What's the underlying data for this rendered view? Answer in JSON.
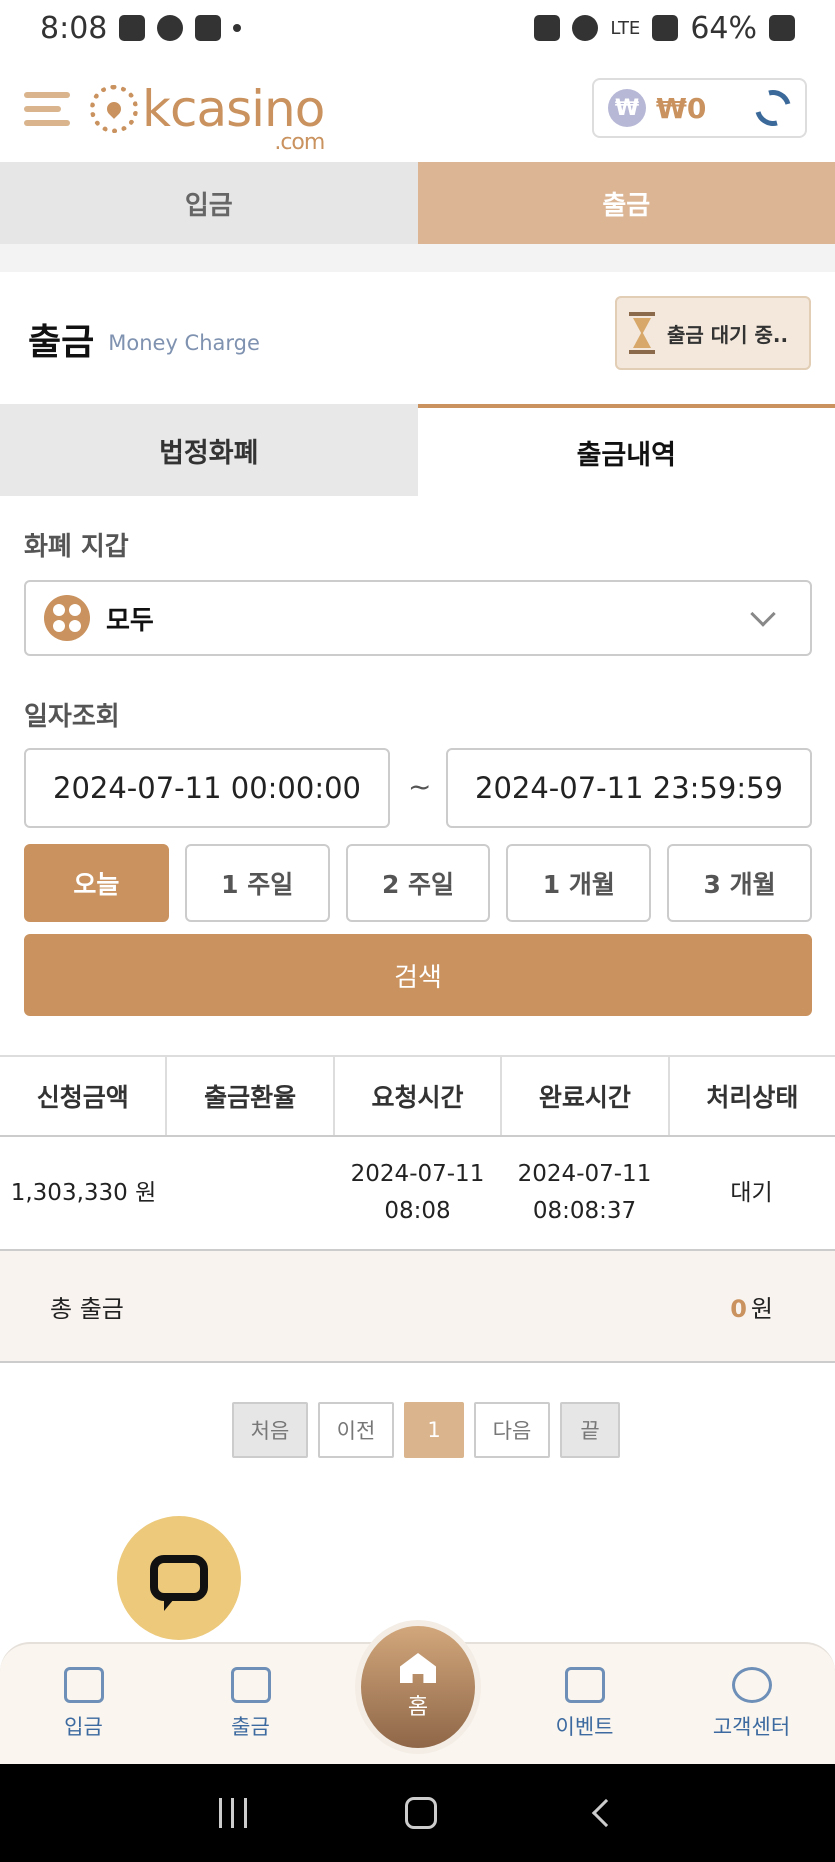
{
  "status_bar": {
    "time": "8:08",
    "battery": "64%",
    "network": "LTE"
  },
  "header": {
    "logo": "kcasino",
    "logo_suffix": ".com",
    "balance": "₩0",
    "currency_symbol": "₩"
  },
  "main_tabs": [
    {
      "label": "입금",
      "active": false
    },
    {
      "label": "출금",
      "active": true
    }
  ],
  "section": {
    "title": "출금",
    "subtitle": "Money Charge",
    "pending_button": "출금 대기 중.."
  },
  "sub_tabs": [
    {
      "label": "법정화폐",
      "active": false
    },
    {
      "label": "출금내역",
      "active": true
    }
  ],
  "wallet": {
    "label": "화폐 지갑",
    "selected": "모두"
  },
  "date_filter": {
    "label": "일자조회",
    "start": "2024-07-11 00:00:00",
    "separator": "~",
    "end": "2024-07-11 23:59:59",
    "periods": [
      "오늘",
      "1 주일",
      "2 주일",
      "1 개월",
      "3 개월"
    ],
    "active_period": "오늘",
    "search_label": "검색"
  },
  "table": {
    "headers": [
      "신청금액",
      "출금환율",
      "요청시간",
      "완료시간",
      "처리상태"
    ],
    "rows": [
      {
        "amount": "1,303,330 원",
        "rate": "",
        "request_date": "2024-07-11",
        "request_time": "08:08",
        "complete_date": "2024-07-11",
        "complete_time": "08:08:37",
        "status": "대기"
      }
    ],
    "total_label": "총 출금",
    "total_value": "0",
    "total_unit": "원"
  },
  "pagination": {
    "first": "처음",
    "prev": "이전",
    "current": "1",
    "next": "다음",
    "last": "끝"
  },
  "bottom_nav": {
    "deposit": "입금",
    "withdraw": "출금",
    "home": "홈",
    "event": "이벤트",
    "support": "고객센터"
  },
  "colors": {
    "accent": "#c9925e",
    "accent_light": "#dbb594",
    "nav_blue": "#3c6aa0",
    "chat_yellow": "#ecc97b"
  }
}
